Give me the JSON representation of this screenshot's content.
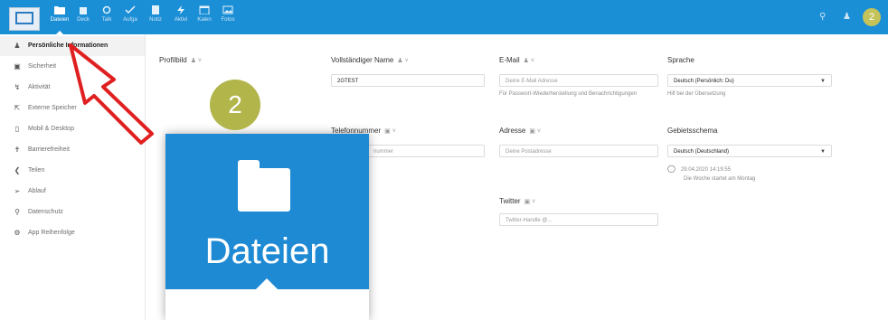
{
  "topbar": {
    "apps": [
      {
        "label": "Dateien",
        "icon": "folder-icon"
      },
      {
        "label": "Deck",
        "icon": "deck-icon"
      },
      {
        "label": "Talk",
        "icon": "search-icon"
      },
      {
        "label": "Aufga",
        "icon": "checkmark-icon"
      },
      {
        "label": "Notiz",
        "icon": "notes-icon"
      },
      {
        "label": "Aktivi",
        "icon": "activity-icon"
      },
      {
        "label": "Kalen",
        "icon": "calendar-icon"
      },
      {
        "label": "Fotos",
        "icon": "image-icon"
      }
    ],
    "avatar_text": "2",
    "accent": "#1b8fd6"
  },
  "sidebar": {
    "items": [
      {
        "label": "Persönliche Informationen",
        "icon": "user-icon"
      },
      {
        "label": "Sicherheit",
        "icon": "lock-icon"
      },
      {
        "label": "Aktivität",
        "icon": "activity-icon"
      },
      {
        "label": "Externe Speicher",
        "icon": "external-storage-icon"
      },
      {
        "label": "Mobil & Desktop",
        "icon": "mobile-icon"
      },
      {
        "label": "Barrierefreiheit",
        "icon": "accessibility-icon"
      },
      {
        "label": "Teilen",
        "icon": "share-icon"
      },
      {
        "label": "Ablauf",
        "icon": "flow-icon"
      },
      {
        "label": "Datenschutz",
        "icon": "key-icon"
      },
      {
        "label": "App Reihenfolge",
        "icon": "gear-icon"
      }
    ]
  },
  "form": {
    "profile_label": "Profilbild",
    "fullname": {
      "label": "Vollständiger Name",
      "value": "2GTEST"
    },
    "email": {
      "label": "E-Mail",
      "placeholder": "Deine E-Mail Adresse",
      "hint": "Für Passwort-Wiederherstellung und Benachrichtigungen"
    },
    "language": {
      "label": "Sprache",
      "value": "Deutsch (Persönlich: Du)",
      "hint": "Hilf bei der Übersetzung"
    },
    "phone": {
      "label": "Telefonnummer",
      "placeholder": "nummer"
    },
    "address": {
      "label": "Adresse",
      "placeholder": "Deine Postadresse"
    },
    "locale": {
      "label": "Gebietsschema",
      "value": "Deutsch (Deutschland)",
      "datetime": "29.04.2020 14:19:55",
      "week_hint": "Die Woche startet am Montag"
    },
    "twitter": {
      "label": "Twitter",
      "placeholder": "Twitter-Handle @..."
    }
  },
  "overlay": {
    "zoom_label": "Dateien",
    "step_number": "2",
    "badge_color": "#b1b54a",
    "arrow_color": "#e02020"
  }
}
